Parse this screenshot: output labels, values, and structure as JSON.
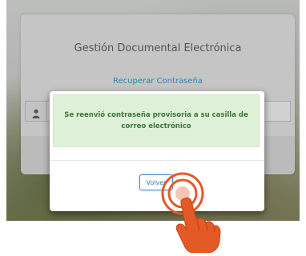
{
  "login": {
    "app_title": "Gestión Documental Electrónica",
    "recover_link": "Recuperar Contraseña",
    "username_icon": "user-icon"
  },
  "modal": {
    "message": "Se reenvió contraseña provisoria a su casilla de correo electrónico",
    "back_button": "Volver"
  },
  "colors": {
    "alert_background": "#dff0d8",
    "alert_text": "#3c763d",
    "link": "#3aa3d8",
    "button_border": "#4a86c7",
    "hand": "#e45a26"
  },
  "annotation_icons": [
    "tap-rings-icon",
    "pointing-hand-icon"
  ]
}
